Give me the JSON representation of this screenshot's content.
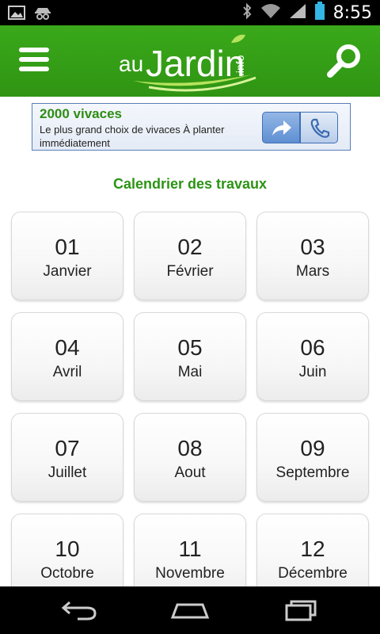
{
  "status_bar": {
    "time": "8:55",
    "icons": [
      "image-icon",
      "incognito-icon",
      "bluetooth-icon",
      "wifi-icon",
      "signal-icon",
      "battery-icon"
    ]
  },
  "header": {
    "logo_main": "auJardin",
    "logo_suffix": ".info",
    "colors": {
      "bar": "#32991a",
      "logo_leaf": "#b6e35c"
    },
    "icons": [
      "menu-icon",
      "search-icon"
    ]
  },
  "ad": {
    "title": "2000 vivaces",
    "text": "Le plus grand choix de vivaces À planter immédiatement",
    "icons": [
      "share-arrow-icon",
      "phone-icon"
    ]
  },
  "calendar": {
    "title": "Calendrier des travaux",
    "months": [
      {
        "num": "01",
        "name": "Janvier"
      },
      {
        "num": "02",
        "name": "Février"
      },
      {
        "num": "03",
        "name": "Mars"
      },
      {
        "num": "04",
        "name": "Avril"
      },
      {
        "num": "05",
        "name": "Mai"
      },
      {
        "num": "06",
        "name": "Juin"
      },
      {
        "num": "07",
        "name": "Juillet"
      },
      {
        "num": "08",
        "name": "Aout"
      },
      {
        "num": "09",
        "name": "Septembre"
      },
      {
        "num": "10",
        "name": "Octobre"
      },
      {
        "num": "11",
        "name": "Novembre"
      },
      {
        "num": "12",
        "name": "Décembre"
      }
    ]
  },
  "nav_bar": {
    "icons": [
      "back-icon",
      "home-icon",
      "recent-apps-icon"
    ]
  }
}
